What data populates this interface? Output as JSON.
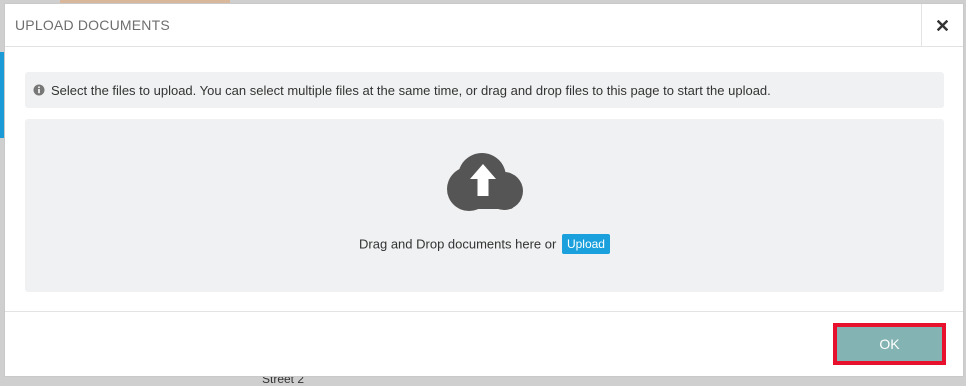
{
  "dialog": {
    "title": "UPLOAD DOCUMENTS",
    "info_message": "Select the files to upload. You can select multiple files at the same time, or drag and drop files to this page to start the upload.",
    "drop_zone": {
      "text": "Drag and Drop documents here or",
      "upload_label": "Upload"
    },
    "footer": {
      "ok_label": "OK"
    }
  },
  "background": {
    "partial_text": "Street 2"
  },
  "colors": {
    "upload_button": "#1aa0dc",
    "ok_button": "#84b3b3",
    "highlight_outline": "#e8112d",
    "panel_background": "#f0f1f2",
    "icon": "#555555"
  },
  "icons": {
    "close": "close-icon",
    "info": "info-icon",
    "cloud_upload": "cloud-upload-icon"
  }
}
